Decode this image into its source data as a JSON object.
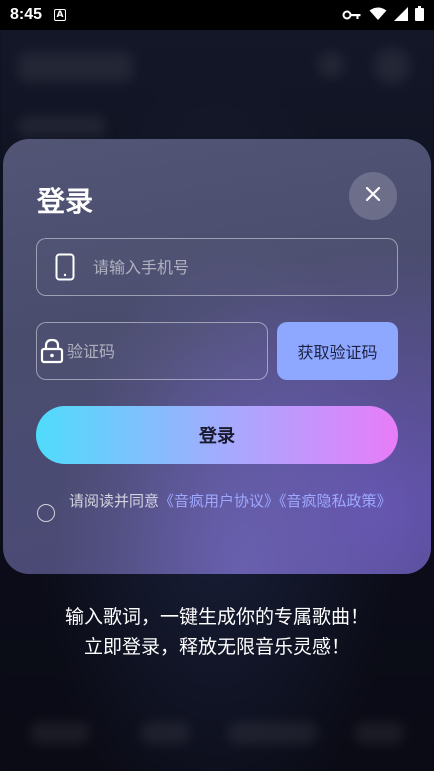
{
  "status_bar": {
    "time": "8:45",
    "a_label": "A"
  },
  "login": {
    "title": "登录",
    "phone_placeholder": "请输入手机号",
    "code_placeholder": "验证码",
    "get_code_label": "获取验证码",
    "login_label": "登录",
    "agreement_prefix": "请阅读并同意",
    "user_agreement_link": "《音疯用户协议》",
    "privacy_policy_link": "《音疯隐私政策》"
  },
  "slogan": {
    "line1": "输入歌词，一键生成你的专属歌曲！",
    "line2": "立即登录，释放无限音乐灵感！"
  },
  "colors": {
    "accent_button": "#8fa8ff",
    "link": "#9ea8ff",
    "gradient_start": "#4fdcfb",
    "gradient_end": "#e87cf8"
  },
  "icons": {
    "key": "key-icon",
    "wifi": "wifi-icon",
    "signal": "signal-icon",
    "battery": "battery-icon",
    "close": "close-icon",
    "phone": "phone-icon",
    "lock": "lock-icon"
  }
}
